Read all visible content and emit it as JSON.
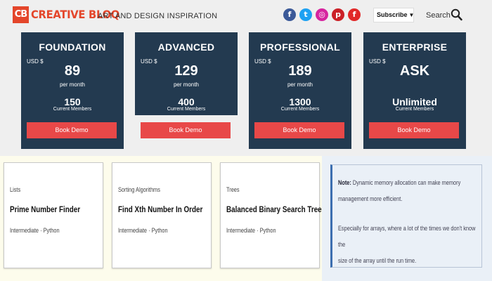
{
  "header": {
    "logo_mark": "CB",
    "logo_text": "CREATIVE BLOQ",
    "tagline": "ART AND DESIGN INSPIRATION",
    "social": [
      {
        "name": "facebook-icon",
        "glyph": "f",
        "color": "#3b5998"
      },
      {
        "name": "twitter-icon",
        "glyph": "t",
        "color": "#1da1f2"
      },
      {
        "name": "instagram-icon",
        "glyph": "◎",
        "color": "#d6249f"
      },
      {
        "name": "pinterest-icon",
        "glyph": "p",
        "color": "#cb2027"
      },
      {
        "name": "flipboard-icon",
        "glyph": "f",
        "color": "#e12828"
      }
    ],
    "subscribe_label": "Subscribe",
    "search_label": "Search"
  },
  "plans": [
    {
      "name": "FOUNDATION",
      "currency": "USD $",
      "price": "89",
      "per": "per month",
      "count": "150",
      "members": "Current Members",
      "button": "Book Demo"
    },
    {
      "name": "ADVANCED",
      "currency": "USD $",
      "price": "129",
      "per": "per month",
      "count": "400",
      "members": "Current Members",
      "button": "Book Demo"
    },
    {
      "name": "PROFESSIONAL",
      "currency": "USD $",
      "price": "189",
      "per": "per month",
      "count": "1300",
      "members": "Current Members",
      "button": "Book Demo"
    },
    {
      "name": "ENTERPRISE",
      "currency": "USD $",
      "price": "ASK",
      "per": "",
      "count": "Unlimited",
      "members": "Current Members",
      "button": "Book Demo"
    }
  ],
  "problems": [
    {
      "topic": "Lists",
      "title": "Prime Number Finder",
      "meta": "Intermediate · Python"
    },
    {
      "topic": "Sorting Algorithms",
      "title": "Find Xth Number In Order",
      "meta": "Intermediate · Python"
    },
    {
      "topic": "Trees",
      "title": "Balanced Binary Search Tree",
      "meta": "Intermediate · Python"
    }
  ],
  "note": {
    "label": "Note:",
    "line1": "Dynamic memory allocation can make memory",
    "line2": "management more efficient.",
    "line3": "Especially for arrays, where a lot of the times we don't know the",
    "line4": "size of the array until the run time."
  },
  "colors": {
    "brand": "#e4462b",
    "card_bg": "#233a50",
    "button": "#e84848"
  }
}
